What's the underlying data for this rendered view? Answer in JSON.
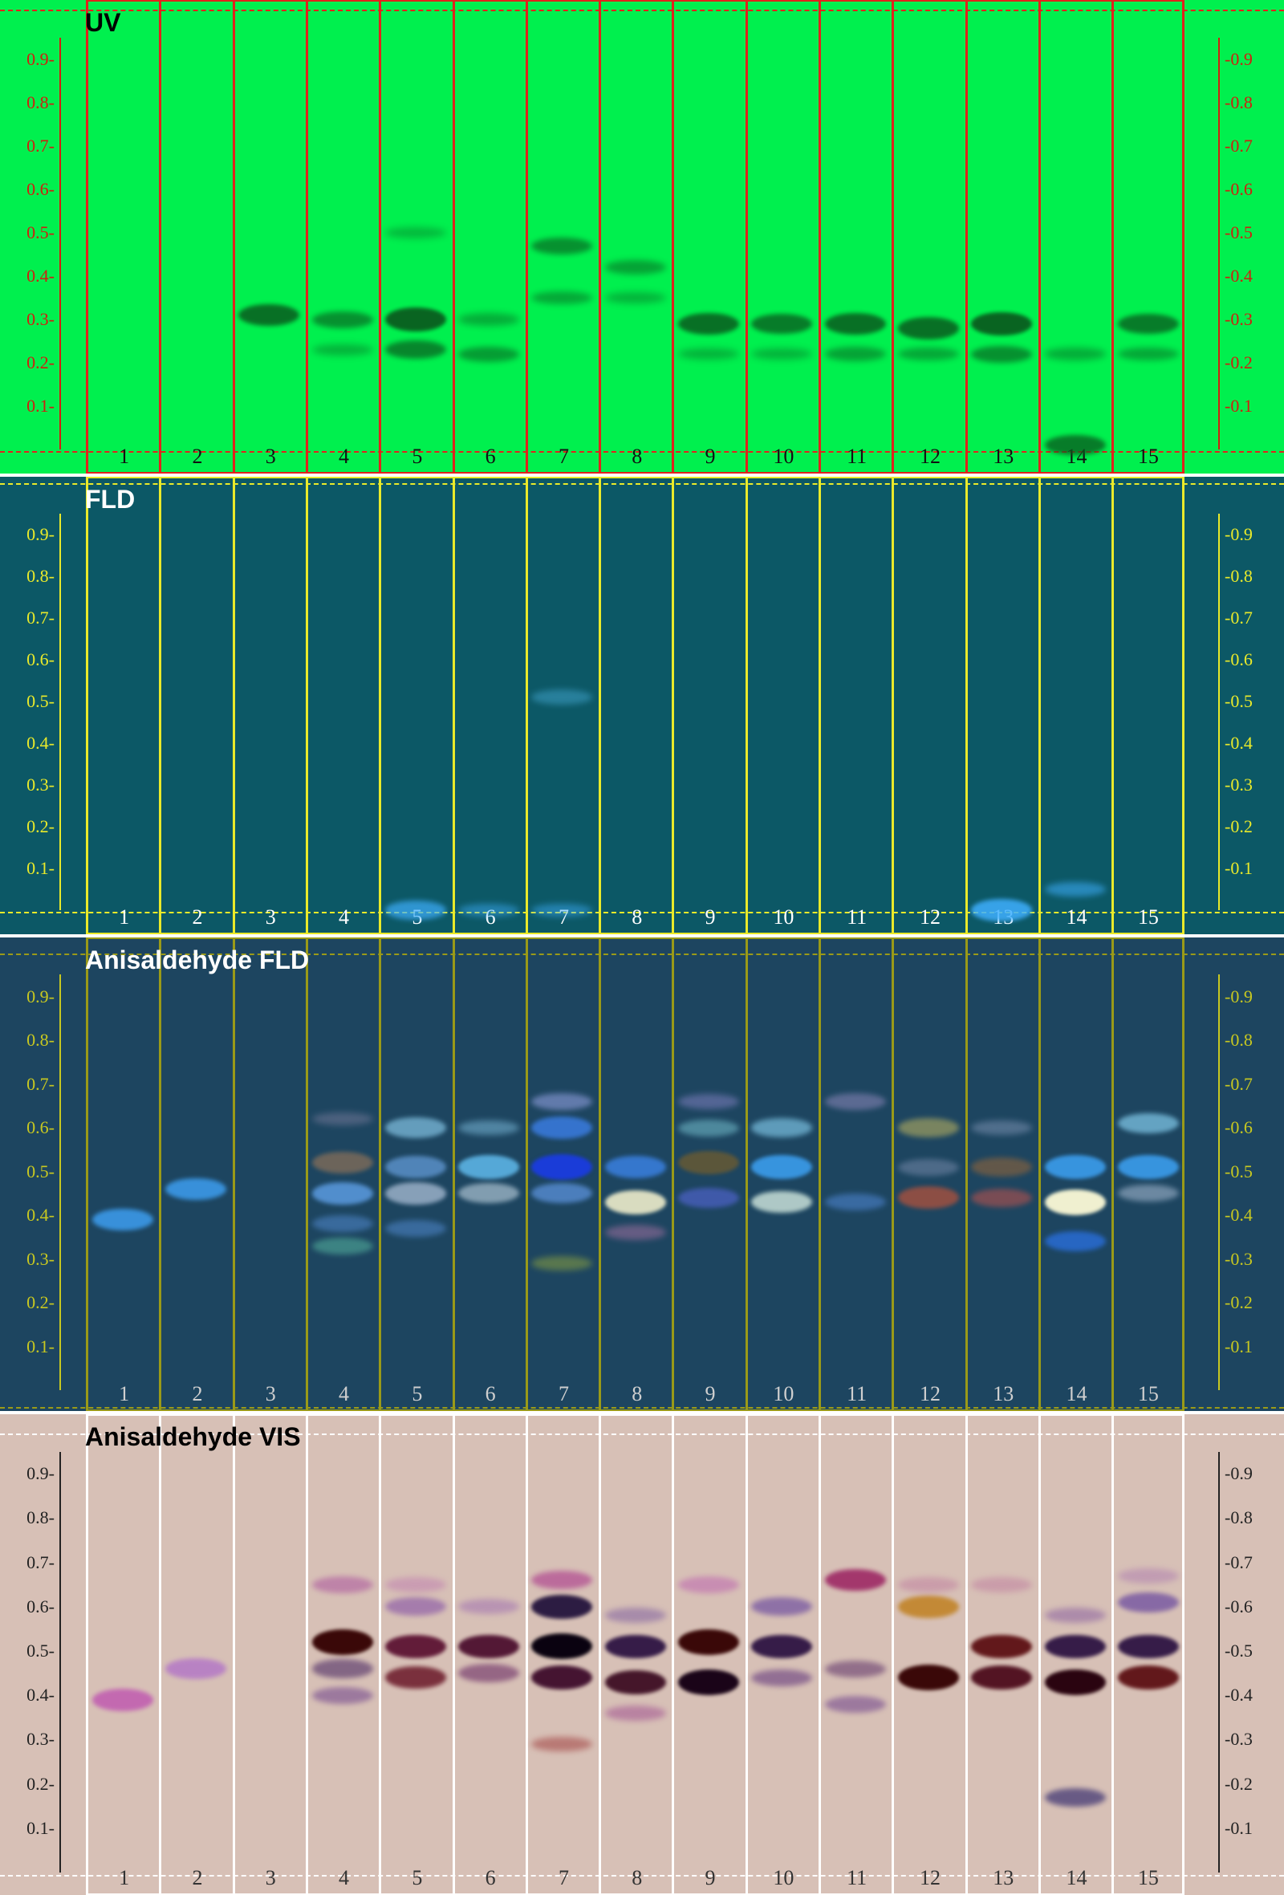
{
  "rf_ticks": [
    "0.9",
    "0.8",
    "0.7",
    "0.6",
    "0.5",
    "0.4",
    "0.3",
    "0.2",
    "0.1"
  ],
  "lane_numbers": [
    "1",
    "2",
    "3",
    "4",
    "5",
    "6",
    "7",
    "8",
    "9",
    "10",
    "11",
    "12",
    "13",
    "14",
    "15"
  ],
  "panels": [
    {
      "id": "uv",
      "title": "UV",
      "colors": {
        "background": "#00f04e",
        "frame": "#e0231c",
        "tick": "#d01e10",
        "title": "#000000",
        "lane_number": "#111111"
      },
      "bands": [
        {
          "lane": 3,
          "rf": 0.31,
          "strength": 0.8,
          "color": "#0a5a1e"
        },
        {
          "lane": 4,
          "rf": 0.3,
          "strength": 0.5,
          "color": "#0a5a1e"
        },
        {
          "lane": 4,
          "rf": 0.23,
          "strength": 0.2,
          "color": "#0a5a1e"
        },
        {
          "lane": 5,
          "rf": 0.3,
          "strength": 0.9,
          "color": "#0a5a1e"
        },
        {
          "lane": 5,
          "rf": 0.23,
          "strength": 0.6,
          "color": "#0a5a1e"
        },
        {
          "lane": 5,
          "rf": 0.5,
          "strength": 0.15,
          "color": "#0a5a1e"
        },
        {
          "lane": 6,
          "rf": 0.3,
          "strength": 0.25,
          "color": "#0a5a1e"
        },
        {
          "lane": 6,
          "rf": 0.22,
          "strength": 0.4,
          "color": "#0a5a1e"
        },
        {
          "lane": 7,
          "rf": 0.47,
          "strength": 0.5,
          "color": "#0a5a1e"
        },
        {
          "lane": 7,
          "rf": 0.35,
          "strength": 0.3,
          "color": "#0a5a1e"
        },
        {
          "lane": 8,
          "rf": 0.42,
          "strength": 0.35,
          "color": "#0a5a1e"
        },
        {
          "lane": 8,
          "rf": 0.35,
          "strength": 0.2,
          "color": "#0a5a1e"
        },
        {
          "lane": 9,
          "rf": 0.29,
          "strength": 0.8,
          "color": "#0a5a1e"
        },
        {
          "lane": 9,
          "rf": 0.22,
          "strength": 0.2,
          "color": "#0a5a1e"
        },
        {
          "lane": 10,
          "rf": 0.29,
          "strength": 0.7,
          "color": "#0a5a1e"
        },
        {
          "lane": 10,
          "rf": 0.22,
          "strength": 0.2,
          "color": "#0a5a1e"
        },
        {
          "lane": 11,
          "rf": 0.29,
          "strength": 0.8,
          "color": "#0a5a1e"
        },
        {
          "lane": 11,
          "rf": 0.22,
          "strength": 0.35,
          "color": "#0a5a1e"
        },
        {
          "lane": 12,
          "rf": 0.28,
          "strength": 0.8,
          "color": "#0a5a1e"
        },
        {
          "lane": 12,
          "rf": 0.22,
          "strength": 0.3,
          "color": "#0a5a1e"
        },
        {
          "lane": 13,
          "rf": 0.29,
          "strength": 0.9,
          "color": "#0a5a1e"
        },
        {
          "lane": 13,
          "rf": 0.22,
          "strength": 0.5,
          "color": "#0a5a1e"
        },
        {
          "lane": 14,
          "rf": 0.22,
          "strength": 0.25,
          "color": "#0a5a1e"
        },
        {
          "lane": 14,
          "rf": 0.01,
          "strength": 0.7,
          "color": "#0a5a1e"
        },
        {
          "lane": 15,
          "rf": 0.29,
          "strength": 0.7,
          "color": "#0a5a1e"
        },
        {
          "lane": 15,
          "rf": 0.22,
          "strength": 0.3,
          "color": "#0a5a1e"
        }
      ]
    },
    {
      "id": "fld",
      "title": "FLD",
      "colors": {
        "background": "#0c5866",
        "frame": "#eaea2a",
        "tick": "#eaea2a",
        "title": "#ffffff",
        "lane_number": "#ffffff"
      },
      "bands": [
        {
          "lane": 7,
          "rf": 0.51,
          "strength": 0.4,
          "color": "#3fa0c8"
        },
        {
          "lane": 5,
          "rf": 0.0,
          "strength": 0.6,
          "color": "#3fb0ff"
        },
        {
          "lane": 6,
          "rf": 0.0,
          "strength": 0.3,
          "color": "#3fb0ff"
        },
        {
          "lane": 7,
          "rf": 0.0,
          "strength": 0.3,
          "color": "#3fb0ff"
        },
        {
          "lane": 13,
          "rf": 0.0,
          "strength": 0.8,
          "color": "#3fb0ff"
        },
        {
          "lane": 14,
          "rf": 0.05,
          "strength": 0.4,
          "color": "#3fb0ff"
        }
      ]
    },
    {
      "id": "anisaldehyde-fld",
      "title": "Anisaldehyde FLD",
      "colors": {
        "background": "#1d4560",
        "frame": "#9a9a18",
        "tick": "#c8c820",
        "title": "#ffffff",
        "lane_number": "#cfcfcf"
      },
      "bands": [
        {
          "lane": 1,
          "rf": 0.39,
          "strength": 0.8,
          "color": "#3d9ef0"
        },
        {
          "lane": 2,
          "rf": 0.46,
          "strength": 0.8,
          "color": "#3d9ef0"
        },
        {
          "lane": 4,
          "rf": 0.52,
          "strength": 0.8,
          "color": "#7a6a5a"
        },
        {
          "lane": 4,
          "rf": 0.45,
          "strength": 0.8,
          "color": "#5b9be0"
        },
        {
          "lane": 4,
          "rf": 0.38,
          "strength": 0.5,
          "color": "#4a80c0"
        },
        {
          "lane": 4,
          "rf": 0.33,
          "strength": 0.5,
          "color": "#4fa898"
        },
        {
          "lane": 4,
          "rf": 0.62,
          "strength": 0.3,
          "color": "#8080a0"
        },
        {
          "lane": 5,
          "rf": 0.6,
          "strength": 0.7,
          "color": "#7ab8d8"
        },
        {
          "lane": 5,
          "rf": 0.51,
          "strength": 0.8,
          "color": "#5a90c8"
        },
        {
          "lane": 5,
          "rf": 0.45,
          "strength": 0.8,
          "color": "#9ab0c8"
        },
        {
          "lane": 5,
          "rf": 0.37,
          "strength": 0.5,
          "color": "#4a80c0"
        },
        {
          "lane": 6,
          "rf": 0.51,
          "strength": 0.9,
          "color": "#5ab0e0"
        },
        {
          "lane": 6,
          "rf": 0.45,
          "strength": 0.7,
          "color": "#a0b8c8"
        },
        {
          "lane": 6,
          "rf": 0.6,
          "strength": 0.4,
          "color": "#7ab8d8"
        },
        {
          "lane": 7,
          "rf": 0.51,
          "strength": 1.0,
          "color": "#1a3cd8"
        },
        {
          "lane": 7,
          "rf": 0.6,
          "strength": 0.8,
          "color": "#3a7ce0"
        },
        {
          "lane": 7,
          "rf": 0.45,
          "strength": 0.7,
          "color": "#5a90d8"
        },
        {
          "lane": 7,
          "rf": 0.66,
          "strength": 0.5,
          "color": "#8a9ad8"
        },
        {
          "lane": 7,
          "rf": 0.29,
          "strength": 0.4,
          "color": "#8aa040"
        },
        {
          "lane": 8,
          "rf": 0.51,
          "strength": 0.8,
          "color": "#3a80e0"
        },
        {
          "lane": 8,
          "rf": 0.43,
          "strength": 0.9,
          "color": "#e8e8c8"
        },
        {
          "lane": 8,
          "rf": 0.36,
          "strength": 0.4,
          "color": "#a070a0"
        },
        {
          "lane": 9,
          "rf": 0.52,
          "strength": 0.9,
          "color": "#605838"
        },
        {
          "lane": 9,
          "rf": 0.44,
          "strength": 0.7,
          "color": "#4a60c0"
        },
        {
          "lane": 9,
          "rf": 0.66,
          "strength": 0.4,
          "color": "#8080c0"
        },
        {
          "lane": 9,
          "rf": 0.6,
          "strength": 0.5,
          "color": "#6ab0c0"
        },
        {
          "lane": 10,
          "rf": 0.51,
          "strength": 0.9,
          "color": "#3a9ae8"
        },
        {
          "lane": 10,
          "rf": 0.43,
          "strength": 0.8,
          "color": "#c8e0d8"
        },
        {
          "lane": 10,
          "rf": 0.6,
          "strength": 0.6,
          "color": "#7ac0e0"
        },
        {
          "lane": 11,
          "rf": 0.66,
          "strength": 0.5,
          "color": "#8080b0"
        },
        {
          "lane": 11,
          "rf": 0.43,
          "strength": 0.5,
          "color": "#4a80c8"
        },
        {
          "lane": 12,
          "rf": 0.6,
          "strength": 0.6,
          "color": "#a0a060"
        },
        {
          "lane": 12,
          "rf": 0.44,
          "strength": 0.8,
          "color": "#a05040"
        },
        {
          "lane": 12,
          "rf": 0.51,
          "strength": 0.5,
          "color": "#6a80a0"
        },
        {
          "lane": 13,
          "rf": 0.51,
          "strength": 0.6,
          "color": "#806040"
        },
        {
          "lane": 13,
          "rf": 0.44,
          "strength": 0.6,
          "color": "#a05050"
        },
        {
          "lane": 13,
          "rf": 0.6,
          "strength": 0.4,
          "color": "#7a90b0"
        },
        {
          "lane": 14,
          "rf": 0.51,
          "strength": 0.9,
          "color": "#3a9ae8"
        },
        {
          "lane": 14,
          "rf": 0.43,
          "strength": 1.0,
          "color": "#f0f0d0"
        },
        {
          "lane": 14,
          "rf": 0.34,
          "strength": 0.7,
          "color": "#2a70e0"
        },
        {
          "lane": 15,
          "rf": 0.51,
          "strength": 0.9,
          "color": "#3a9ae8"
        },
        {
          "lane": 15,
          "rf": 0.61,
          "strength": 0.7,
          "color": "#7ac0e0"
        },
        {
          "lane": 15,
          "rf": 0.45,
          "strength": 0.5,
          "color": "#9ab0c8"
        }
      ]
    },
    {
      "id": "anisaldehyde-vis",
      "title": "Anisaldehyde VIS",
      "colors": {
        "background": "#d7c0b6",
        "frame": "#ffffff",
        "tick": "#222222",
        "title": "#000000",
        "lane_number": "#333333"
      },
      "bands": [
        {
          "lane": 1,
          "rf": 0.39,
          "strength": 0.8,
          "color": "#c05ab0"
        },
        {
          "lane": 2,
          "rf": 0.46,
          "strength": 0.7,
          "color": "#b070c8"
        },
        {
          "lane": 4,
          "rf": 0.52,
          "strength": 1.0,
          "color": "#3a0808"
        },
        {
          "lane": 4,
          "rf": 0.65,
          "strength": 0.5,
          "color": "#b060a0"
        },
        {
          "lane": 4,
          "rf": 0.46,
          "strength": 0.6,
          "color": "#604070"
        },
        {
          "lane": 4,
          "rf": 0.4,
          "strength": 0.5,
          "color": "#7a5090"
        },
        {
          "lane": 5,
          "rf": 0.51,
          "strength": 0.9,
          "color": "#5a1030"
        },
        {
          "lane": 5,
          "rf": 0.44,
          "strength": 0.8,
          "color": "#6a1828"
        },
        {
          "lane": 5,
          "rf": 0.6,
          "strength": 0.6,
          "color": "#9060a8"
        },
        {
          "lane": 5,
          "rf": 0.65,
          "strength": 0.4,
          "color": "#c080b0"
        },
        {
          "lane": 6,
          "rf": 0.51,
          "strength": 0.9,
          "color": "#4a0c2c"
        },
        {
          "lane": 6,
          "rf": 0.45,
          "strength": 0.6,
          "color": "#7a4070"
        },
        {
          "lane": 6,
          "rf": 0.6,
          "strength": 0.4,
          "color": "#a070b0"
        },
        {
          "lane": 7,
          "rf": 0.51,
          "strength": 1.0,
          "color": "#0a0210"
        },
        {
          "lane": 7,
          "rf": 0.6,
          "strength": 0.9,
          "color": "#20103a"
        },
        {
          "lane": 7,
          "rf": 0.44,
          "strength": 0.9,
          "color": "#3a0828"
        },
        {
          "lane": 7,
          "rf": 0.66,
          "strength": 0.6,
          "color": "#b04890"
        },
        {
          "lane": 7,
          "rf": 0.29,
          "strength": 0.4,
          "color": "#a04040"
        },
        {
          "lane": 8,
          "rf": 0.51,
          "strength": 0.9,
          "color": "#2a1040"
        },
        {
          "lane": 8,
          "rf": 0.43,
          "strength": 0.9,
          "color": "#3a0a20"
        },
        {
          "lane": 8,
          "rf": 0.58,
          "strength": 0.4,
          "color": "#8060a0"
        },
        {
          "lane": 8,
          "rf": 0.36,
          "strength": 0.4,
          "color": "#a05090"
        },
        {
          "lane": 9,
          "rf": 0.52,
          "strength": 1.0,
          "color": "#3a0808"
        },
        {
          "lane": 9,
          "rf": 0.43,
          "strength": 1.0,
          "color": "#1a0418"
        },
        {
          "lane": 9,
          "rf": 0.65,
          "strength": 0.5,
          "color": "#c070b0"
        },
        {
          "lane": 10,
          "rf": 0.51,
          "strength": 0.9,
          "color": "#2a1040"
        },
        {
          "lane": 10,
          "rf": 0.6,
          "strength": 0.6,
          "color": "#7050a0"
        },
        {
          "lane": 10,
          "rf": 0.44,
          "strength": 0.5,
          "color": "#6a4080"
        },
        {
          "lane": 11,
          "rf": 0.66,
          "strength": 0.8,
          "color": "#9a2060"
        },
        {
          "lane": 11,
          "rf": 0.46,
          "strength": 0.5,
          "color": "#6a4070"
        },
        {
          "lane": 11,
          "rf": 0.38,
          "strength": 0.5,
          "color": "#7a5090"
        },
        {
          "lane": 12,
          "rf": 0.6,
          "strength": 0.8,
          "color": "#c08020"
        },
        {
          "lane": 12,
          "rf": 0.44,
          "strength": 1.0,
          "color": "#3a0808"
        },
        {
          "lane": 12,
          "rf": 0.65,
          "strength": 0.4,
          "color": "#c080a0"
        },
        {
          "lane": 13,
          "rf": 0.51,
          "strength": 0.9,
          "color": "#5a0c10"
        },
        {
          "lane": 13,
          "rf": 0.44,
          "strength": 0.9,
          "color": "#4a0818"
        },
        {
          "lane": 13,
          "rf": 0.65,
          "strength": 0.4,
          "color": "#c080a0"
        },
        {
          "lane": 14,
          "rf": 0.51,
          "strength": 0.9,
          "color": "#2a1040"
        },
        {
          "lane": 14,
          "rf": 0.43,
          "strength": 1.0,
          "color": "#2a0410"
        },
        {
          "lane": 14,
          "rf": 0.58,
          "strength": 0.4,
          "color": "#8a60a0"
        },
        {
          "lane": 14,
          "rf": 0.17,
          "strength": 0.6,
          "color": "#3a3070"
        },
        {
          "lane": 15,
          "rf": 0.51,
          "strength": 0.9,
          "color": "#2a1040"
        },
        {
          "lane": 15,
          "rf": 0.44,
          "strength": 0.9,
          "color": "#5a0c10"
        },
        {
          "lane": 15,
          "rf": 0.61,
          "strength": 0.7,
          "color": "#7050a0"
        },
        {
          "lane": 15,
          "rf": 0.67,
          "strength": 0.4,
          "color": "#b080b0"
        }
      ]
    }
  ]
}
